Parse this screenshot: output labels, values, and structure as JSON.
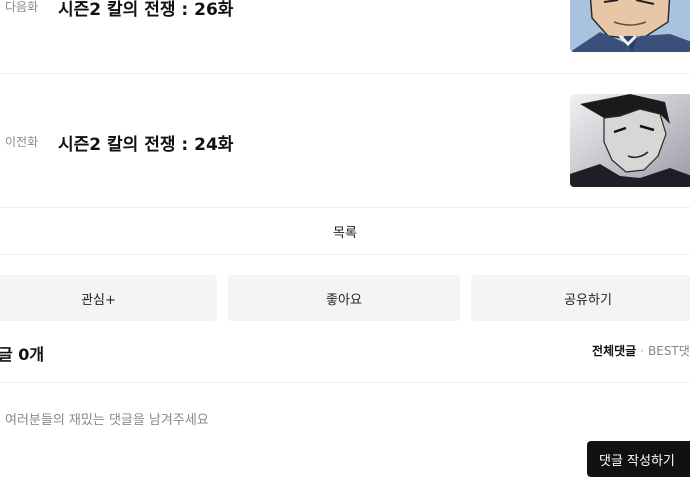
{
  "episode_nav": {
    "next": {
      "label": "다음화",
      "title": "시즌2 칼의 전쟁 : 26화"
    },
    "prev": {
      "label": "이전화",
      "title": "시즌2 칼의 전쟁 : 24화"
    }
  },
  "list_button": "목록",
  "actions": {
    "interest": "관심+",
    "like": "좋아요",
    "share": "공유하기"
  },
  "comments": {
    "count_label": "글 0개",
    "sort_all": "전체댓글",
    "sort_separator": "·",
    "sort_best": "BEST댓",
    "placeholder": "여러분들의 재밌는 댓글을 남겨주세요",
    "write_button": "댓글 작성하기"
  },
  "colors": {
    "button_bg": "#f4f4f4",
    "write_button_bg": "#111111",
    "divider": "#ededed"
  }
}
